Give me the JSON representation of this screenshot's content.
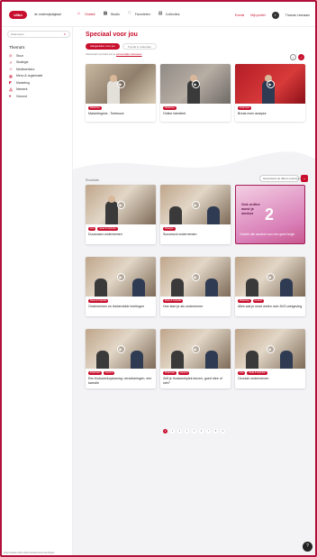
{
  "header": {
    "logo": "vitbo",
    "tagline": "de onderwijsdigitaal",
    "nav": [
      {
        "label": "Ontdek",
        "icon": "compass-icon",
        "active": true
      },
      {
        "label": "Studio",
        "icon": "film-icon",
        "active": false
      },
      {
        "label": "Favorieten",
        "icon": "heart-icon",
        "active": false
      },
      {
        "label": "Collecties",
        "icon": "folder-icon",
        "active": false
      }
    ],
    "links": [
      "Events",
      "Mijn profiel"
    ],
    "avatar_initial": "T",
    "user_name": "Thomas Leenaars"
  },
  "sidebar": {
    "search_placeholder": "Zoek items",
    "themes_title": "Thema's",
    "themes": [
      {
        "label": "Stuur",
        "icon": "compass-icon"
      },
      {
        "label": "Strategie",
        "icon": "chart-icon"
      },
      {
        "label": "Medewerkers",
        "icon": "users-icon"
      },
      {
        "label": "Menu & organisatie",
        "icon": "grid-icon"
      },
      {
        "label": "Marketing",
        "icon": "megaphone-icon"
      },
      {
        "label": "Netwerk",
        "icon": "network-icon"
      },
      {
        "label": "Gezond",
        "icon": "heart-icon"
      }
    ]
  },
  "featured": {
    "title": "Speciaal voor jou",
    "chips": [
      "Aangeraden voor jou",
      "Trends in onderwijs"
    ],
    "hint_prefix": "Interessant op basis van je",
    "hint_link": "persoonlijke interesses",
    "cards": [
      {
        "tag": "Marketing",
        "title": "Marketingmix - Toetsscol",
        "thumb": "warm"
      },
      {
        "tag": "Marketing",
        "title": "Online Identiteit",
        "thumb": "grey"
      },
      {
        "tag": "Financieel",
        "title": "Break even analyse",
        "thumb": "red"
      }
    ]
  },
  "catalog": {
    "results_label": "Resultaten",
    "sort_label": "Gesorteerd op datum (nieuw-oud)",
    "cards": [
      {
        "tags": [
          "Live",
          "Ideas & inspiratie"
        ],
        "title": "Duurzaam ondernemen"
      },
      {
        "tags": [
          "Strategie"
        ],
        "title": "Succesvol ondernemen"
      },
      {
        "tags": [
          "Ideas & inspiratie"
        ],
        "title": "Ondernemen en lesbereidde leerlingen"
      },
      {
        "tags": [
          "Ideas & inspiratie"
        ],
        "title": "Hoe start je als ondernemer"
      },
      {
        "tags": [
          "Marketing",
          "Gezond"
        ],
        "title": "Alles wat je moet weten over AVG-wetgeving"
      },
      {
        "tags": [
          "Financieel",
          "Gezond"
        ],
        "title": "Een thuiswerkoplossing: verzekeringen, een kwestie"
      },
      {
        "tags": [
          "Financieel",
          "Gezond"
        ],
        "title": "Zelf je thuiswerkplek kiezen, goed idee of niet?"
      },
      {
        "tags": [
          "Live",
          "Ideas & inspiratie"
        ],
        "title": "Circulair ondernemen"
      }
    ],
    "promo": {
      "headline": "Ook online word je sterker",
      "number": "2",
      "caption": "Ontdek alle aanbod voor een goed begin"
    },
    "pages": [
      "1",
      "2",
      "3",
      "4",
      "5",
      "6",
      "7",
      "8",
      "9"
    ],
    "active_page": "1"
  },
  "status_text": "https://studio.vitbo.nl/item/ondernemen-leerlingen",
  "colors": {
    "accent": "#c8102e",
    "promo": "#d97fb8"
  }
}
